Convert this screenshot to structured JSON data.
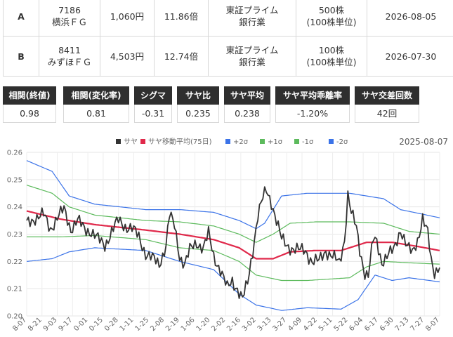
{
  "pairs": [
    {
      "label": "A",
      "code": "7186",
      "name": "横浜ＦＧ",
      "price": "1,060円",
      "per": "11.86倍",
      "market": "東証プライム",
      "sector": "銀行業",
      "unit": "500株",
      "unit_note": "(100株単位)",
      "date": "2026-08-05"
    },
    {
      "label": "B",
      "code": "8411",
      "name": "みずほＦＧ",
      "price": "4,503円",
      "per": "12.74倍",
      "market": "東証プライム",
      "sector": "銀行業",
      "unit": "100株",
      "unit_note": "(100株単位)",
      "date": "2026-07-30"
    }
  ],
  "metrics": [
    {
      "label": "相関(終値)",
      "value": "0.98"
    },
    {
      "label": "相関(変化率)",
      "value": "0.81"
    },
    {
      "label": "シグマ",
      "value": "-0.31"
    },
    {
      "label": "サヤ比",
      "value": "0.235"
    },
    {
      "label": "サヤ平均",
      "value": "0.238"
    },
    {
      "label": "サヤ平均乖離率",
      "value": "-1.20%"
    },
    {
      "label": "サヤ交差回数",
      "value": "42回"
    }
  ],
  "chart": {
    "date_label": "2025-08-07",
    "legend": [
      {
        "label": "サヤ",
        "color": "#333333"
      },
      {
        "label": "サヤ移動平均(75日)",
        "color": "#e0284a"
      },
      {
        "label": "+2σ",
        "color": "#3b73e8"
      },
      {
        "label": "+1σ",
        "color": "#5cba5c"
      },
      {
        "label": "-1σ",
        "color": "#5cba5c"
      },
      {
        "label": "-2σ",
        "color": "#3b73e8"
      }
    ]
  },
  "chart_data": {
    "type": "line",
    "ylim": [
      0.2,
      0.26
    ],
    "yticks": [
      "0.26",
      "0.25",
      "0.24",
      "0.23",
      "0.22",
      "0.21",
      "0.20"
    ],
    "xticks": [
      "8-07",
      "8-21",
      "9-03",
      "9-17",
      "0-01",
      "0-15",
      "0-28",
      "1-11",
      "1-25",
      "2-08",
      "2-19",
      "1-06",
      "1-20",
      "2-02",
      "2-16",
      "3-02",
      "3-13",
      "3-27",
      "4-09",
      "4-22",
      "5-11",
      "5-22",
      "6-04",
      "6-17",
      "6-30",
      "7-13",
      "7-27",
      "8-07"
    ],
    "n_points": 244,
    "series": [
      {
        "name": "サヤ",
        "color": "#333333",
        "anchors": [
          [
            0,
            0.234
          ],
          [
            5,
            0.236
          ],
          [
            10,
            0.237
          ],
          [
            14,
            0.232
          ],
          [
            18,
            0.236
          ],
          [
            22,
            0.239
          ],
          [
            26,
            0.232
          ],
          [
            30,
            0.235
          ],
          [
            34,
            0.232
          ],
          [
            38,
            0.231
          ],
          [
            42,
            0.228
          ],
          [
            46,
            0.226
          ],
          [
            50,
            0.231
          ],
          [
            54,
            0.235
          ],
          [
            58,
            0.233
          ],
          [
            62,
            0.232
          ],
          [
            66,
            0.229
          ],
          [
            70,
            0.223
          ],
          [
            74,
            0.221
          ],
          [
            78,
            0.219
          ],
          [
            82,
            0.226
          ],
          [
            84,
            0.237
          ],
          [
            87,
            0.233
          ],
          [
            90,
            0.222
          ],
          [
            93,
            0.219
          ],
          [
            96,
            0.224
          ],
          [
            100,
            0.227
          ],
          [
            104,
            0.225
          ],
          [
            107,
            0.23
          ],
          [
            110,
            0.222
          ],
          [
            114,
            0.217
          ],
          [
            118,
            0.21
          ],
          [
            121,
            0.213
          ],
          [
            124,
            0.21
          ],
          [
            127,
            0.206
          ],
          [
            130,
            0.212
          ],
          [
            133,
            0.224
          ],
          [
            136,
            0.237
          ],
          [
            139,
            0.243
          ],
          [
            141,
            0.246
          ],
          [
            144,
            0.242
          ],
          [
            147,
            0.235
          ],
          [
            150,
            0.228
          ],
          [
            153,
            0.226
          ],
          [
            156,
            0.225
          ],
          [
            160,
            0.224
          ],
          [
            164,
            0.224
          ],
          [
            168,
            0.22
          ],
          [
            172,
            0.22
          ],
          [
            176,
            0.224
          ],
          [
            180,
            0.222
          ],
          [
            184,
            0.219
          ],
          [
            187,
            0.228
          ],
          [
            189,
            0.245
          ],
          [
            191,
            0.238
          ],
          [
            194,
            0.232
          ],
          [
            196,
            0.224
          ],
          [
            199,
            0.216
          ],
          [
            201,
            0.215
          ],
          [
            204,
            0.228
          ],
          [
            206,
            0.227
          ],
          [
            209,
            0.22
          ],
          [
            212,
            0.222
          ],
          [
            216,
            0.224
          ],
          [
            220,
            0.232
          ],
          [
            224,
            0.225
          ],
          [
            227,
            0.223
          ],
          [
            230,
            0.228
          ],
          [
            233,
            0.236
          ],
          [
            236,
            0.23
          ],
          [
            238,
            0.22
          ],
          [
            240,
            0.216
          ],
          [
            243,
            0.219
          ]
        ]
      },
      {
        "name": "サヤ移動平均(75日)",
        "color": "#e0284a",
        "anchors": [
          [
            0,
            0.2385
          ],
          [
            20,
            0.2355
          ],
          [
            40,
            0.2335
          ],
          [
            70,
            0.2315
          ],
          [
            90,
            0.23
          ],
          [
            110,
            0.228
          ],
          [
            125,
            0.225
          ],
          [
            135,
            0.221
          ],
          [
            145,
            0.221
          ],
          [
            155,
            0.2235
          ],
          [
            170,
            0.224
          ],
          [
            185,
            0.224
          ],
          [
            200,
            0.227
          ],
          [
            215,
            0.227
          ],
          [
            230,
            0.2255
          ],
          [
            243,
            0.224
          ]
        ]
      },
      {
        "name": "+2σ",
        "color": "#3b73e8",
        "anchors": [
          [
            0,
            0.257
          ],
          [
            15,
            0.253
          ],
          [
            25,
            0.244
          ],
          [
            40,
            0.241
          ],
          [
            70,
            0.239
          ],
          [
            90,
            0.239
          ],
          [
            110,
            0.238
          ],
          [
            125,
            0.235
          ],
          [
            135,
            0.232
          ],
          [
            140,
            0.234
          ],
          [
            150,
            0.244
          ],
          [
            165,
            0.245
          ],
          [
            190,
            0.245
          ],
          [
            210,
            0.243
          ],
          [
            220,
            0.239
          ],
          [
            243,
            0.236
          ]
        ]
      },
      {
        "name": "+1σ",
        "color": "#5cba5c",
        "anchors": [
          [
            0,
            0.248
          ],
          [
            15,
            0.245
          ],
          [
            25,
            0.24
          ],
          [
            40,
            0.237
          ],
          [
            70,
            0.235
          ],
          [
            90,
            0.2345
          ],
          [
            110,
            0.233
          ],
          [
            125,
            0.23
          ],
          [
            135,
            0.227
          ],
          [
            145,
            0.23
          ],
          [
            155,
            0.234
          ],
          [
            170,
            0.2345
          ],
          [
            190,
            0.2345
          ],
          [
            210,
            0.234
          ],
          [
            225,
            0.231
          ],
          [
            243,
            0.23
          ]
        ]
      },
      {
        "name": "-1σ",
        "color": "#5cba5c",
        "anchors": [
          [
            0,
            0.229
          ],
          [
            20,
            0.229
          ],
          [
            40,
            0.2295
          ],
          [
            70,
            0.228
          ],
          [
            90,
            0.225
          ],
          [
            110,
            0.224
          ],
          [
            125,
            0.22
          ],
          [
            135,
            0.215
          ],
          [
            150,
            0.213
          ],
          [
            165,
            0.213
          ],
          [
            190,
            0.214
          ],
          [
            200,
            0.218
          ],
          [
            210,
            0.22
          ],
          [
            225,
            0.2195
          ],
          [
            243,
            0.219
          ]
        ]
      },
      {
        "name": "-2σ",
        "color": "#3b73e8",
        "anchors": [
          [
            0,
            0.22
          ],
          [
            15,
            0.221
          ],
          [
            25,
            0.2235
          ],
          [
            40,
            0.225
          ],
          [
            70,
            0.224
          ],
          [
            90,
            0.22
          ],
          [
            110,
            0.217
          ],
          [
            125,
            0.208
          ],
          [
            135,
            0.204
          ],
          [
            150,
            0.202
          ],
          [
            165,
            0.203
          ],
          [
            185,
            0.2025
          ],
          [
            195,
            0.206
          ],
          [
            205,
            0.215
          ],
          [
            215,
            0.213
          ],
          [
            225,
            0.214
          ],
          [
            243,
            0.2125
          ]
        ]
      }
    ]
  }
}
